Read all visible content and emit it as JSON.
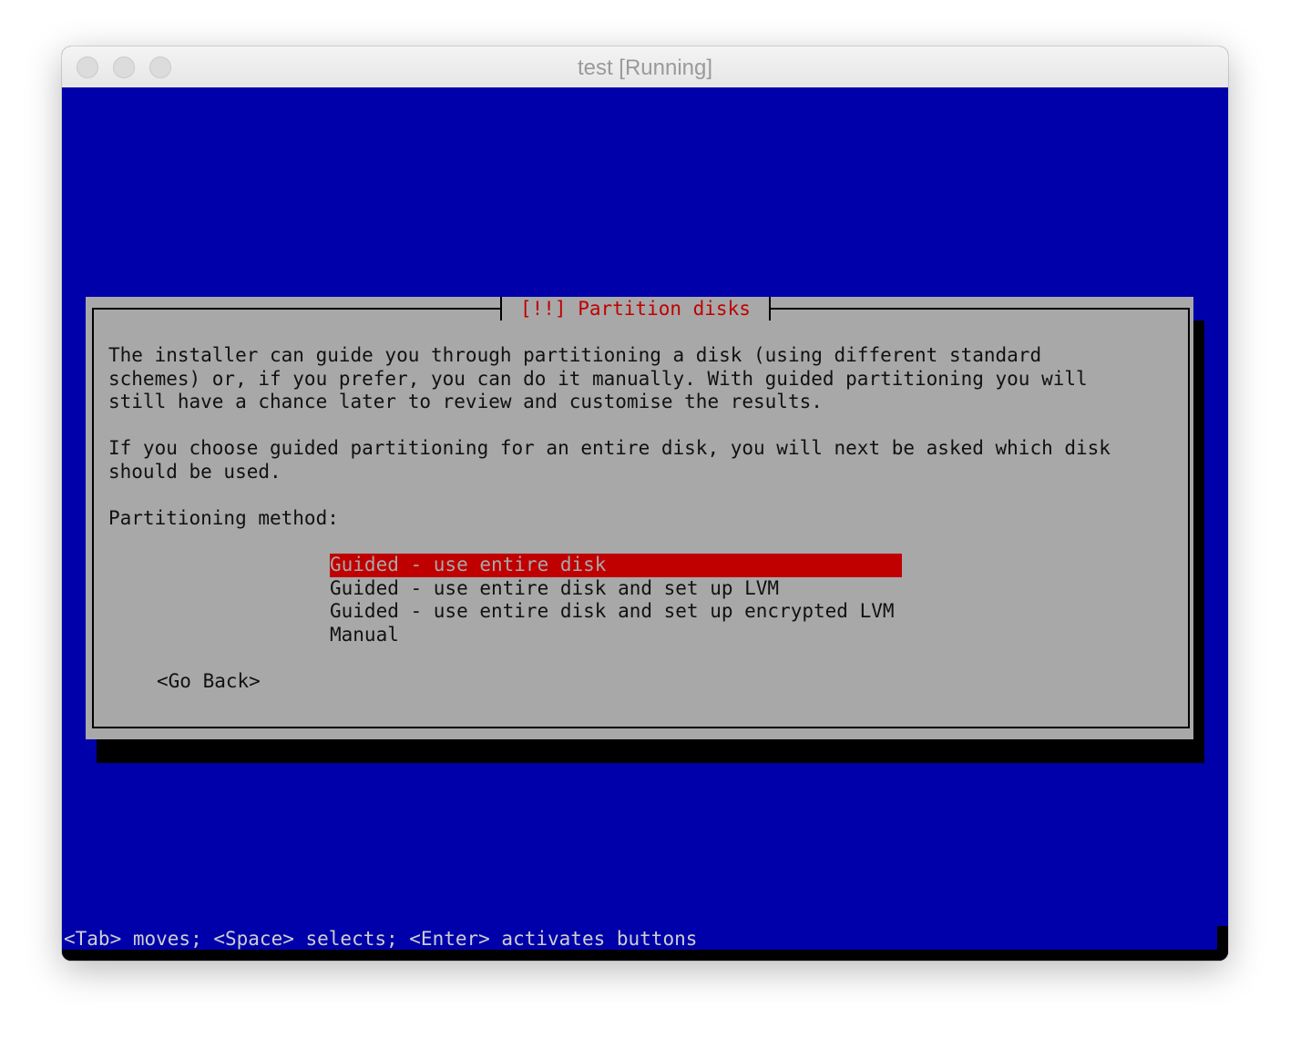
{
  "window": {
    "title": "test [Running]"
  },
  "dialog": {
    "title": "[!!] Partition disks",
    "paragraph1": [
      "The installer can guide you through partitioning a disk (using different standard",
      "schemes) or, if you prefer, you can do it manually. With guided partitioning you will",
      "still have a chance later to review and customise the results."
    ],
    "paragraph2": [
      "If you choose guided partitioning for an entire disk, you will next be asked which disk",
      "should be used."
    ],
    "prompt": "Partitioning method:",
    "options": [
      "Guided - use entire disk",
      "Guided - use entire disk and set up LVM",
      "Guided - use entire disk and set up encrypted LVM",
      "Manual"
    ],
    "selected_index": 0,
    "go_back": "<Go Back>"
  },
  "statusbar": {
    "help": "<Tab> moves; <Space> selects; <Enter> activates buttons"
  },
  "colors": {
    "screen_bg": "#0000aa",
    "dialog_bg": "#a8a8a8",
    "accent": "#c00000"
  }
}
